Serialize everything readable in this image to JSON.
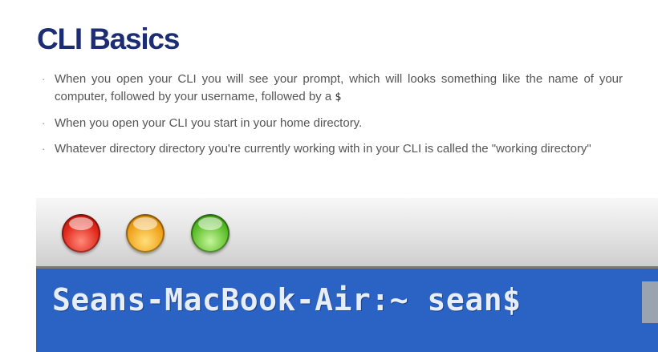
{
  "slide": {
    "title": "CLI Basics",
    "bullet_marker": "·",
    "bullets": [
      {
        "text": "When you open your CLI you will see your prompt, which will looks something like the name of your computer, followed by your username, followed by a ",
        "code": "$"
      },
      {
        "text": "When you open your CLI you start in your home directory."
      },
      {
        "text": "Whatever directory directory you're currently working with in your CLI is called the \"working directory\""
      }
    ]
  },
  "terminal": {
    "prompt": "Seans-MacBook-Air:~ sean$",
    "colors": {
      "background": "#2a63c4",
      "text": "#e8eef8",
      "close": "#e0281b",
      "minimize": "#f0a21a",
      "zoom": "#5cbf2a"
    }
  },
  "colors": {
    "title": "#1d2d74",
    "body_text": "#555555"
  }
}
